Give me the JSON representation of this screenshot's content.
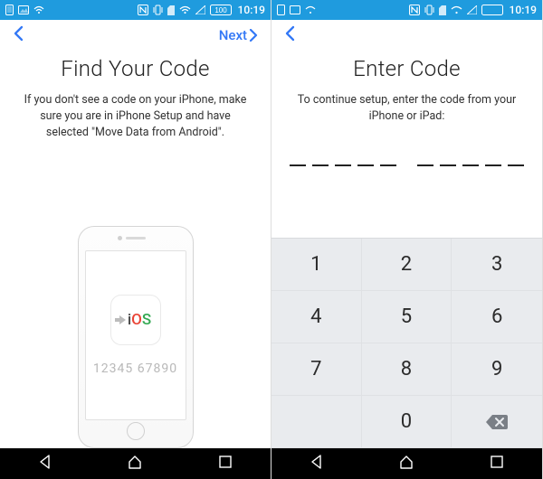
{
  "status": {
    "time": "10:19",
    "battery": "100"
  },
  "left": {
    "nextLabel": "Next",
    "title": "Find Your Code",
    "subtitle": "If you don't see a code on your iPhone, make sure you are in iPhone Setup and have selected \"Move Data from Android\".",
    "phoneLogo": {
      "letters": [
        "i",
        "O",
        "S"
      ]
    },
    "phoneCode": "12345 67890"
  },
  "right": {
    "title": "Enter Code",
    "subtitle": "To continue setup, enter the code from your iPhone or iPad:",
    "codeLength": 10,
    "keypad": [
      "1",
      "2",
      "3",
      "4",
      "5",
      "6",
      "7",
      "8",
      "9",
      "",
      "0",
      "⌫"
    ]
  }
}
